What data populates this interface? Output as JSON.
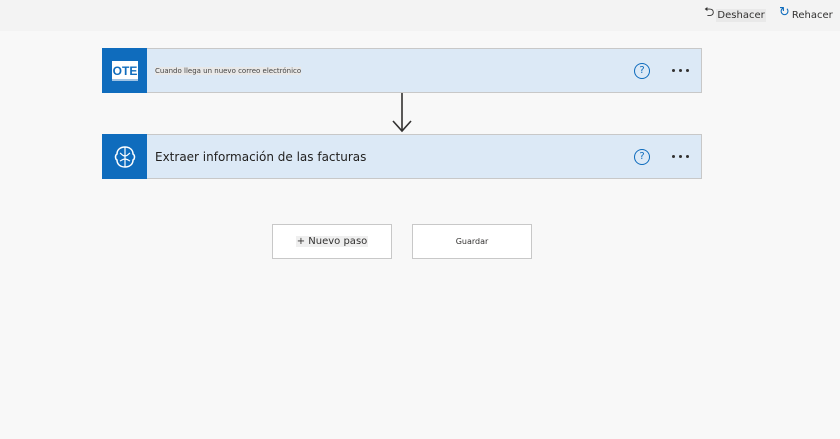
{
  "toolbar": {
    "undo_label": "Deshacer",
    "redo_label": "Rehacer"
  },
  "steps": [
    {
      "icon_text": "OTE",
      "icon": "outlook-mail-icon",
      "title": "Cuando llega un nuevo correo electrónico",
      "help_glyph": "?"
    },
    {
      "icon": "ai-brain-icon",
      "title": "Extraer información de las facturas",
      "help_glyph": "?"
    }
  ],
  "actions": {
    "new_step_label": "+ Nuevo paso",
    "save_label": "Guardar"
  },
  "colors": {
    "accent": "#0f6cbd",
    "card_bg": "#dce9f6",
    "page_bg": "#f8f8f8"
  }
}
